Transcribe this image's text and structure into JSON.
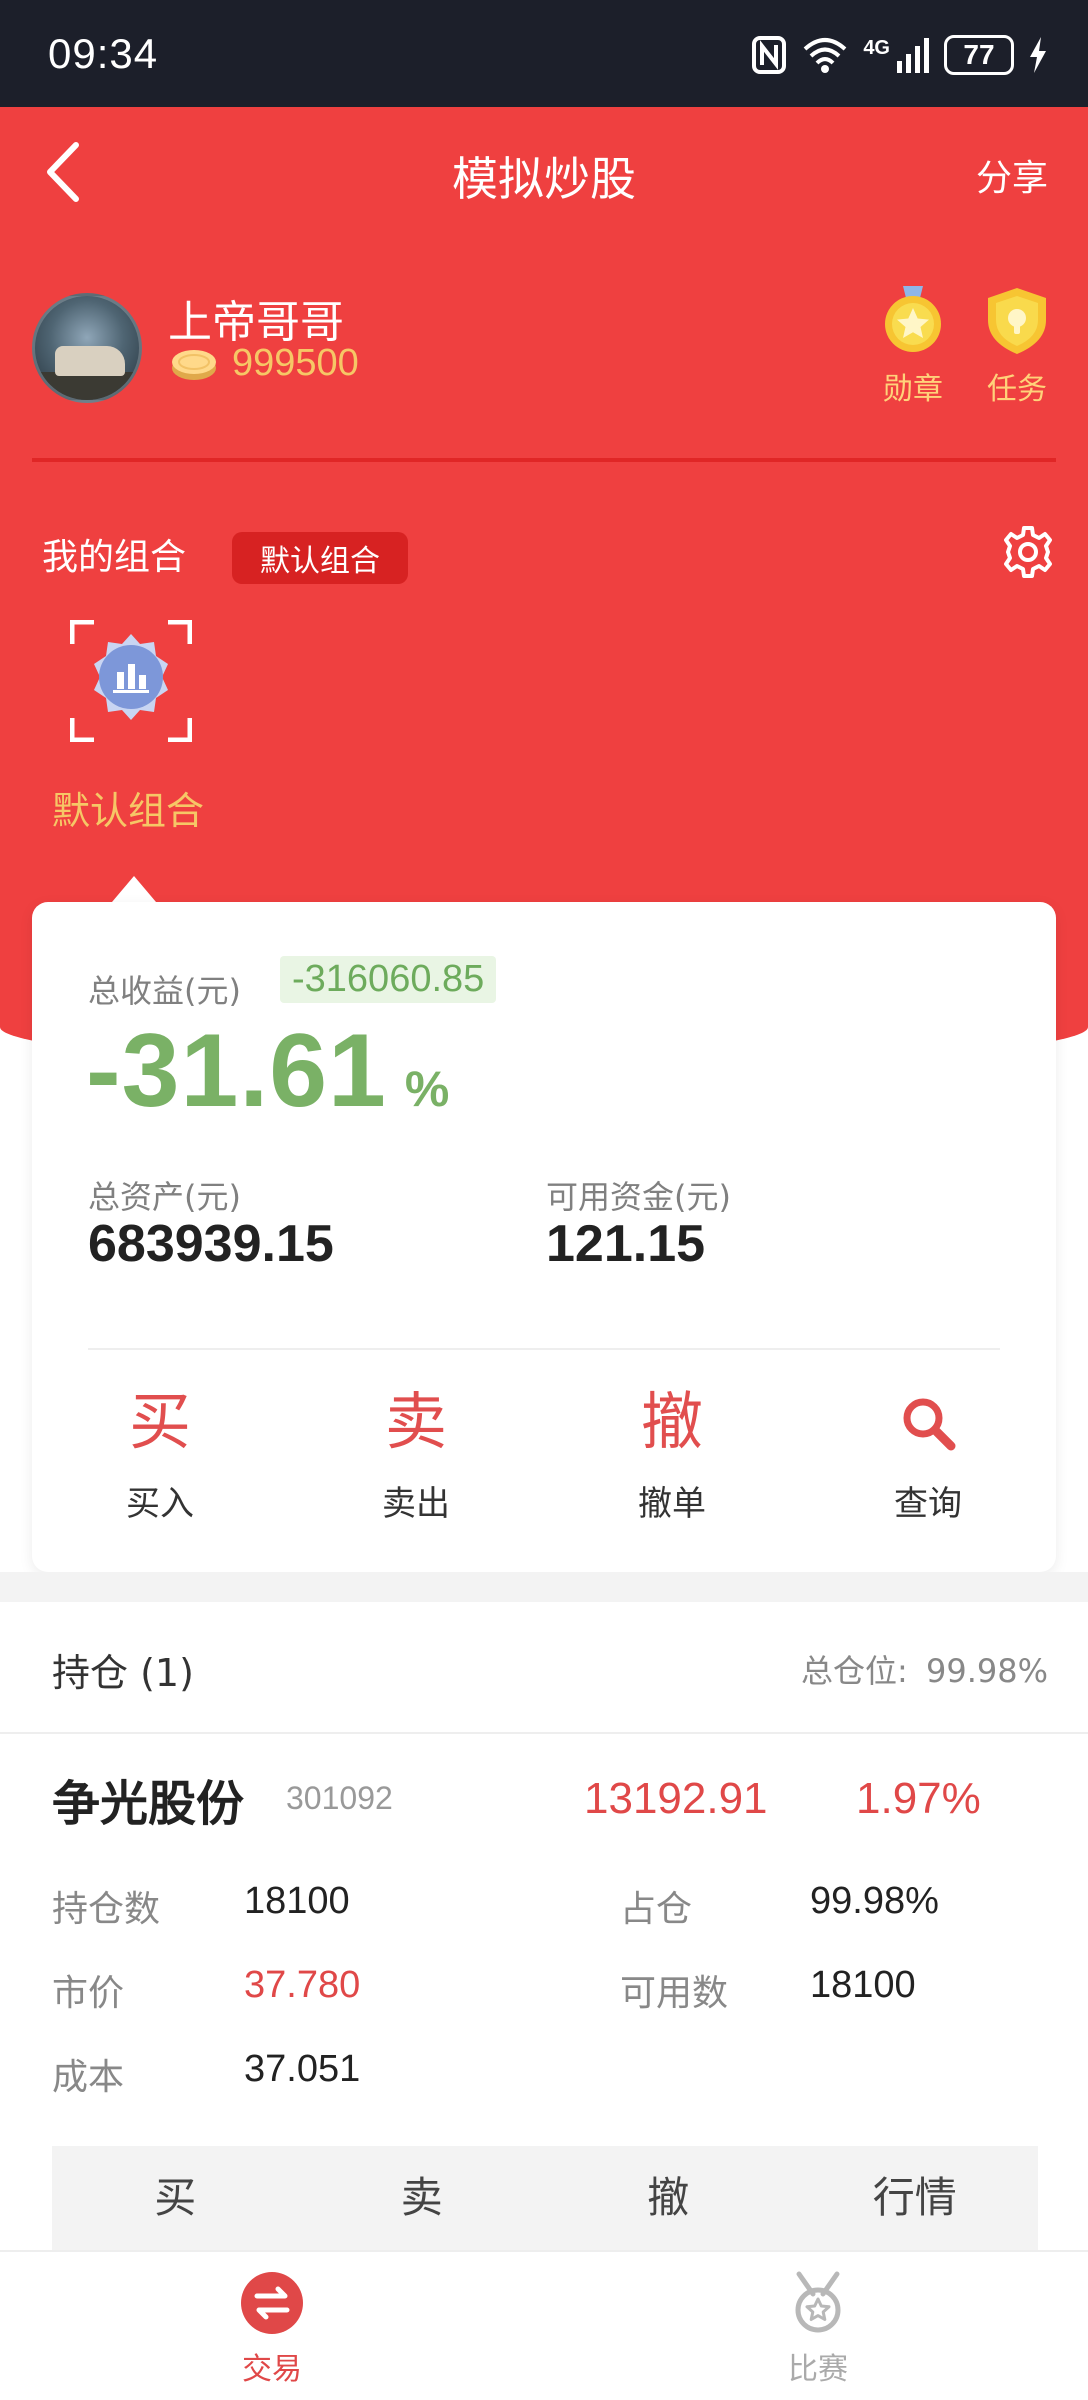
{
  "status_bar": {
    "time": "09:34",
    "network": "4G",
    "battery": "77"
  },
  "nav": {
    "title": "模拟炒股",
    "share_label": "分享"
  },
  "profile": {
    "username": "上帝哥哥",
    "coins": "999500"
  },
  "badges": [
    {
      "label": "勋章",
      "icon": "medal-icon"
    },
    {
      "label": "任务",
      "icon": "task-shield-icon"
    }
  ],
  "combo": {
    "title": "我的组合",
    "tag": "默认组合",
    "selected_label": "默认组合"
  },
  "summary": {
    "total_profit_label": "总收益(元)",
    "total_profit_value": "-316060.85",
    "return_pct": "-31.61",
    "pct_sign": "%",
    "total_assets_label": "总资产(元)",
    "total_assets_value": "683939.15",
    "available_cash_label": "可用资金(元)",
    "available_cash_value": "121.15"
  },
  "actions": [
    {
      "glyph": "买",
      "label": "买入"
    },
    {
      "glyph": "卖",
      "label": "卖出"
    },
    {
      "glyph": "撤",
      "label": "撤单"
    },
    {
      "glyph": "",
      "label": "查询"
    }
  ],
  "holdings": {
    "title": "持仓 (1)",
    "ratio_label": "总仓位:",
    "ratio_value": "99.98%",
    "stock": {
      "name": "争光股份",
      "code": "301092",
      "profit": "13192.91",
      "profit_pct": "1.97%",
      "fields": {
        "qty_label": "持仓数",
        "qty_value": "18100",
        "weight_label": "占仓",
        "weight_value": "99.98%",
        "price_label": "市价",
        "price_value": "37.780",
        "avail_label": "可用数",
        "avail_value": "18100",
        "cost_label": "成本",
        "cost_value": "37.051"
      },
      "buttons": [
        "买",
        "卖",
        "撤",
        "行情"
      ]
    }
  },
  "tabbar": [
    {
      "label": "交易",
      "active": true
    },
    {
      "label": "比赛",
      "active": false
    }
  ],
  "colors": {
    "brand_red": "#ef4040",
    "loss_green": "#7ab166",
    "gain_red": "#e04848",
    "gold": "#f6c766"
  }
}
